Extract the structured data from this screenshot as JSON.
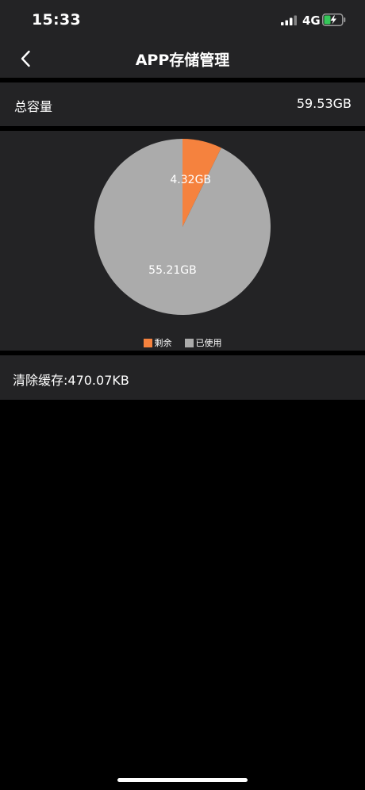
{
  "status_bar": {
    "time": "15:33",
    "network": "4G",
    "signal_icon": "signal-bars-icon",
    "battery_icon": "battery-charging-icon"
  },
  "nav": {
    "back_icon": "chevron-left-icon",
    "title": "APP存储管理"
  },
  "total": {
    "label": "总容量",
    "value": "59.53GB"
  },
  "chart_data": {
    "type": "pie",
    "slices": [
      {
        "name": "剩余",
        "value": 4.32,
        "label": "4.32GB",
        "color": "#F5823E"
      },
      {
        "name": "已使用",
        "value": 55.21,
        "label": "55.21GB",
        "color": "#ABABAB"
      }
    ],
    "legend_position": "bottom"
  },
  "cache": {
    "label": "清除缓存:470.07KB"
  },
  "colors": {
    "background": "#000000",
    "panel": "#232325",
    "accent": "#F5823E",
    "used": "#ABABAB"
  }
}
